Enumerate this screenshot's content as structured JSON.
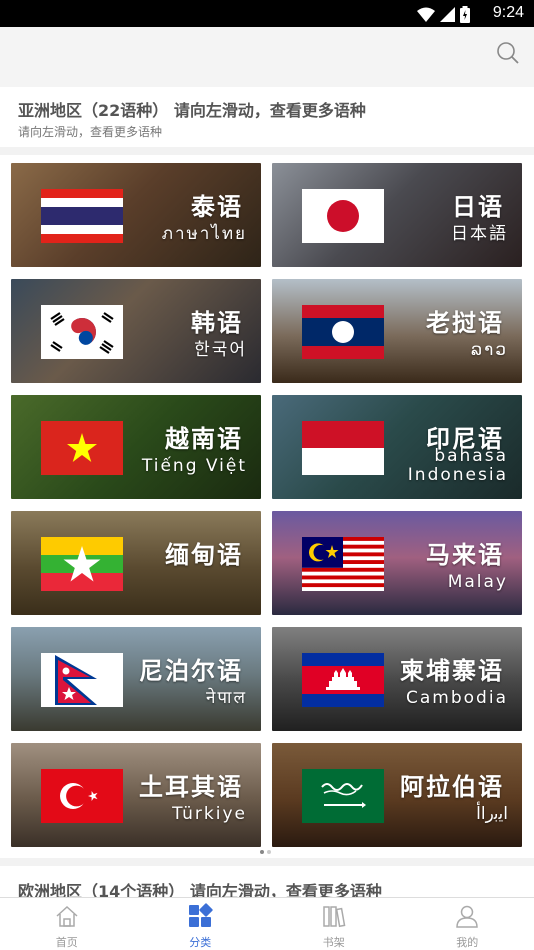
{
  "status_bar": {
    "time": "9:24"
  },
  "search": {
    "icon": "search-icon"
  },
  "asia_section": {
    "title": "亚洲地区（22语种） 请向左滑动，查看更多语种",
    "subtitle": "请向左滑动，查看更多语种"
  },
  "languages": [
    {
      "name": "泰语",
      "native": "ภาษาไทย",
      "flag": "thailand"
    },
    {
      "name": "日语",
      "native": "日本語",
      "flag": "japan"
    },
    {
      "name": "韩语",
      "native": "한국어",
      "flag": "korea"
    },
    {
      "name": "老挝语",
      "native": "ລາວ",
      "flag": "laos"
    },
    {
      "name": "越南语",
      "native": "Tiếng Việt",
      "flag": "vietnam"
    },
    {
      "name": "印尼语",
      "native": "bahasa",
      "native2": "Indonesia",
      "flag": "indonesia"
    },
    {
      "name": "缅甸语",
      "native": "",
      "flag": "myanmar"
    },
    {
      "name": "马来语",
      "native": "Malay",
      "flag": "malaysia"
    },
    {
      "name": "尼泊尔语",
      "native": "नेपाल",
      "flag": "nepal"
    },
    {
      "name": "柬埔寨语",
      "native": "Cambodia",
      "flag": "cambodia"
    },
    {
      "name": "土耳其语",
      "native": "Türkiye",
      "flag": "turkey"
    },
    {
      "name": "阿拉伯语",
      "native": "اﻳﺑﺭﺍﺃ",
      "flag": "saudi"
    }
  ],
  "pager": {
    "pages": 2,
    "current": 1
  },
  "europe_section": {
    "title": "欧洲地区（14个语种） 请向左滑动，查看更多语种"
  },
  "tabbar": {
    "items": [
      {
        "label": "首页",
        "icon": "home-icon",
        "active": false
      },
      {
        "label": "分类",
        "icon": "category-icon",
        "active": true
      },
      {
        "label": "书架",
        "icon": "bookshelf-icon",
        "active": false
      },
      {
        "label": "我的",
        "icon": "profile-icon",
        "active": false
      }
    ],
    "active_color": "#3b6fd6",
    "inactive_color": "#999999"
  }
}
